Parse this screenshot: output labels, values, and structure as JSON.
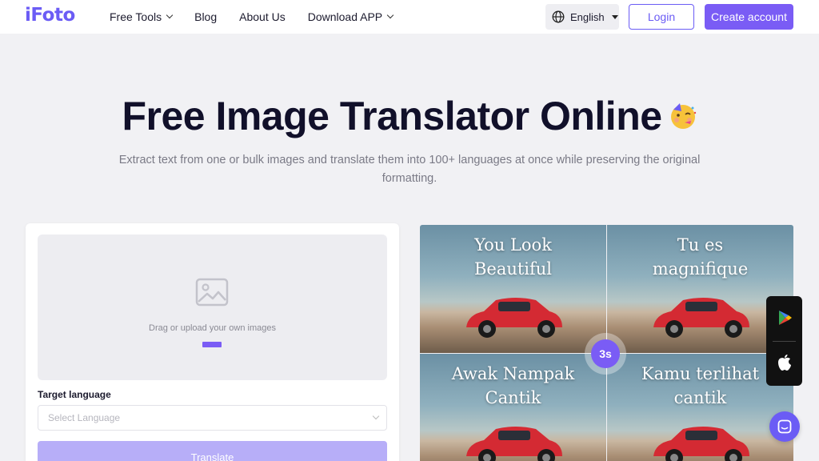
{
  "header": {
    "logo": "iFoto",
    "nav": [
      {
        "label": "Free Tools",
        "has_dropdown": true
      },
      {
        "label": "Blog",
        "has_dropdown": false
      },
      {
        "label": "About Us",
        "has_dropdown": false
      },
      {
        "label": "Download APP",
        "has_dropdown": true
      }
    ],
    "language": "English",
    "login_label": "Login",
    "create_account_label": "Create account"
  },
  "hero": {
    "title": "Free Image Translator Online",
    "subtitle": "Extract text from one or bulk images and translate them into 100+ languages at once while preserving the original formatting."
  },
  "uploader": {
    "drop_text": "Drag or upload your own images",
    "target_label": "Target language",
    "select_placeholder": "Select Language",
    "translate_label": "Translate"
  },
  "preview": {
    "tiles": [
      {
        "caption_line1": "You Look",
        "caption_line2": "Beautiful"
      },
      {
        "caption_line1": "Tu es",
        "caption_line2": "magnifique"
      },
      {
        "caption_line1": "Awak Nampak",
        "caption_line2": "Cantik"
      },
      {
        "caption_line1": "Kamu terlihat",
        "caption_line2": "cantik"
      }
    ],
    "timer": "3s"
  },
  "colors": {
    "accent": "#7a5cf5",
    "accent_light": "#b7aef8",
    "background": "#f1f1f4"
  },
  "icons": [
    "globe-icon",
    "chevron-down-icon",
    "image-placeholder-icon",
    "google-play-icon",
    "apple-icon",
    "chat-icon",
    "party-face-emoji"
  ]
}
